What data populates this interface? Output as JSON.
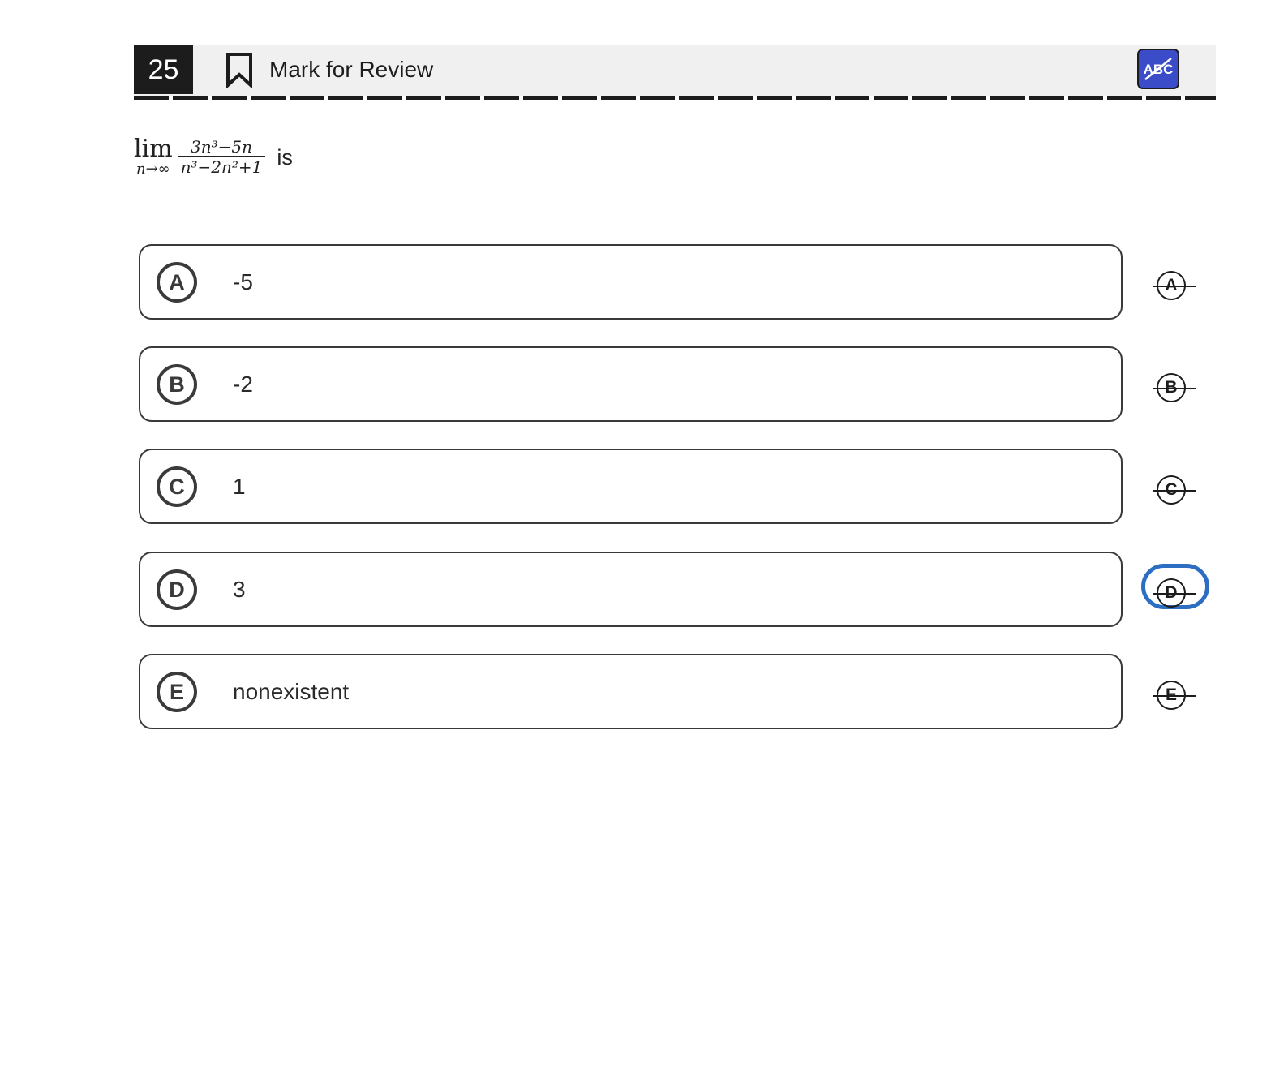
{
  "header": {
    "question_number": "25",
    "mark_for_review_label": "Mark for Review",
    "abc_button_label": "ABC"
  },
  "question": {
    "lim_word": "lim",
    "lim_subscript": "n→∞",
    "numerator": "3n³−5n",
    "denominator": "n³−2n²+1",
    "suffix": "is"
  },
  "options": [
    {
      "letter": "A",
      "text": "-5"
    },
    {
      "letter": "B",
      "text": "-2"
    },
    {
      "letter": "C",
      "text": "1"
    },
    {
      "letter": "D",
      "text": "3"
    },
    {
      "letter": "E",
      "text": "nonexistent"
    }
  ],
  "strike_buttons": [
    {
      "letter": "A",
      "focused": false
    },
    {
      "letter": "B",
      "focused": false
    },
    {
      "letter": "C",
      "focused": false
    },
    {
      "letter": "D",
      "focused": true
    },
    {
      "letter": "E",
      "focused": false
    }
  ],
  "colors": {
    "abc_button": "#3b4cc9",
    "focus_ring": "#2d6ec2",
    "question_number_bg": "#1c1c1c",
    "header_bg": "#f0f0f0"
  }
}
